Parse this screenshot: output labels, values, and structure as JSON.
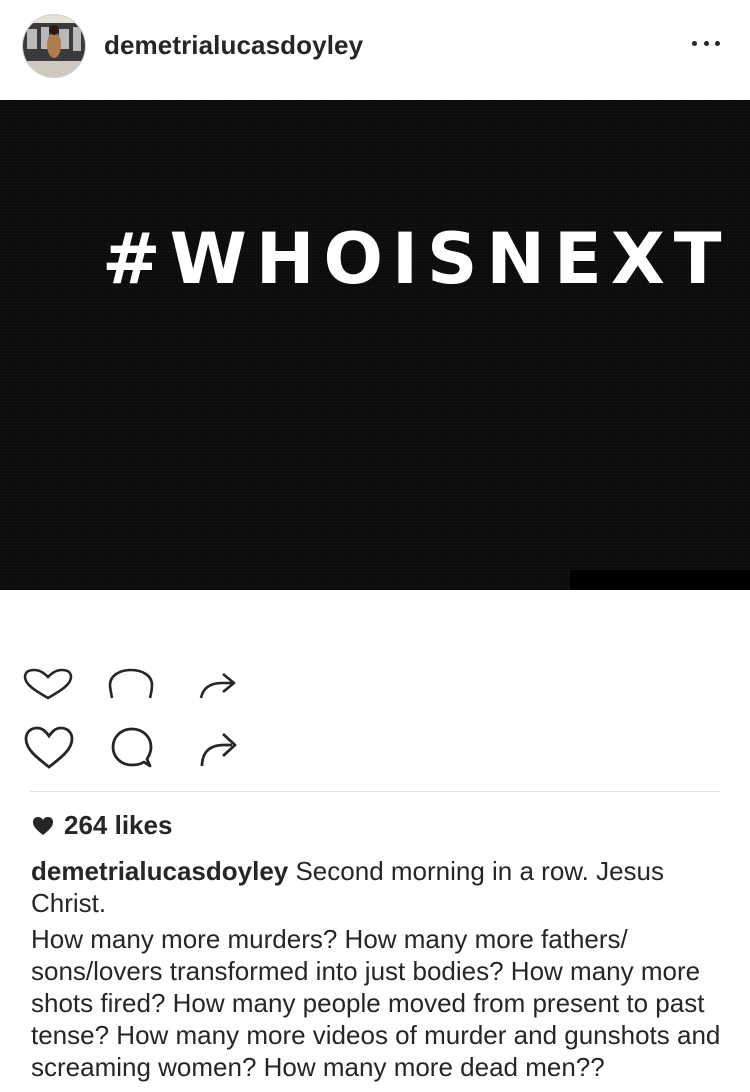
{
  "post": {
    "username": "demetrialucasdoyley",
    "image_text": "#WHOISNEXT",
    "likes": "264 likes",
    "caption_user": "demetrialucasdoyley",
    "caption_line1": "Second morning in a row. Jesus Christ.",
    "caption_line2": "How many more murders? How many more fathers/ sons/lovers transformed into just bodies? How many more shots fired? How many people moved from present to past tense? How many more videos of murder and gunshots and screaming women? How many more dead men??"
  },
  "icons": {
    "more": "more-options-icon",
    "like": "heart-icon",
    "comment": "comment-icon",
    "share": "share-icon"
  }
}
